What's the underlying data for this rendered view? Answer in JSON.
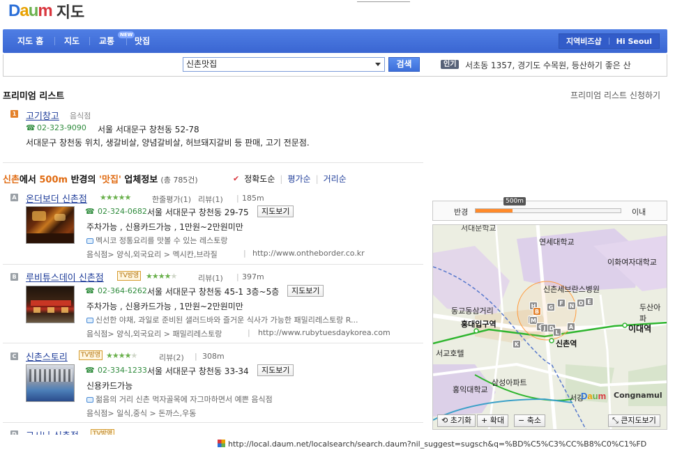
{
  "header": {
    "logo_text": "Daum",
    "title": "지도"
  },
  "nav": {
    "items": [
      "지도 홈",
      "지도",
      "교통",
      "맛집"
    ],
    "new_badge": "NEW",
    "right": [
      "지역비즈샵",
      "Hi Seoul"
    ]
  },
  "search": {
    "query": "신촌맛집",
    "button": "검색",
    "popular_badge": "인기",
    "popular_text": "서초동 1357, 경기도 수목원, 등산하기 좋은 산"
  },
  "premium": {
    "title": "프리미엄 리스트",
    "apply_link": "프리미엄 리스트 신청하기",
    "item": {
      "num": "1",
      "name": "고기창고",
      "category": "음식점",
      "phone": "02-323-9090",
      "address": "서울 서대문구 창천동 52-78",
      "desc": "서대문구 창천동 위치, 생갈비살, 양념갈비살, 허브돼지갈비 등 판매, 고기 전문점."
    }
  },
  "section": {
    "place": "신촌",
    "mid1": "에서 ",
    "radius": "500m",
    "mid2": " 반경의 ",
    "keyword": "'맛집'",
    "tail": " 업체정보",
    "count": "(총 785건)",
    "sorts": [
      "정확도순",
      "평가순",
      "거리순"
    ]
  },
  "results": [
    {
      "num": "A",
      "name": "온더보더 신촌점",
      "rating": 5,
      "rating_label": "한줄평가(1)",
      "review": "리뷰(1)",
      "distance": "185m",
      "phone": "02-324-0682",
      "address": "서울 서대문구 창천동 29-75",
      "map_button": "지도보기",
      "info": "주차가능 , 신용카드가능 , 1만원~2만원미만",
      "desc": "멕시코 정통요리를 맛볼 수 있는 레스토랑",
      "category": "음식점> 양식,외국요리 > 멕시칸,브라질",
      "url": "http://www.ontheborder.co.kr"
    },
    {
      "num": "B",
      "name": "루비튜스데이 신촌점",
      "tv": "TV방영",
      "rating": 4,
      "review": "리뷰(1)",
      "distance": "397m",
      "phone": "02-364-6262",
      "address": "서울 서대문구 창천동 45-1 3층~5층",
      "map_button": "지도보기",
      "info": "주차가능 , 신용카드가능 , 1만원~2만원미만",
      "desc": "신선한 야채, 과일로 준비된 샐러드바와 즐거운 식사가 가능한 패밀리레스토랑 R...",
      "category": "음식점> 양식,외국요리 > 패밀리레스토랑",
      "url": "http://www.rubytuesdaykorea.com"
    },
    {
      "num": "C",
      "name": "신촌스토리",
      "tv": "TV방영",
      "rating": 4,
      "review": "리뷰(2)",
      "distance": "308m",
      "phone": "02-334-1233",
      "address": "서울 서대문구 창천동 33-34",
      "map_button": "지도보기",
      "info": "신용카드가능",
      "desc": "젊음의 거리 신촌 먹자골목에 자그마하면서 예쁜 음식점",
      "category": "음식점> 일식,중식 > 돈까스,우동"
    },
    {
      "num": "D",
      "name": "고시나 신촌점",
      "tv": "TV방영"
    }
  ],
  "map": {
    "radius_label": "반경",
    "radius_value": "500m",
    "radius_level": 0.25,
    "radius_suffix": "이내",
    "labels": {
      "yonsei": "연세대학교",
      "severance": "신촌세브란스병원",
      "ewha": "이화여자대학교",
      "ewha_station": "이대역",
      "dongkyo": "동교동삼거리",
      "hongik_station": "홍대입구역",
      "sinchon_station": "신촌역",
      "seogyo_hotel": "서교호텔",
      "hongik_univ": "홍익대학교",
      "samsung_apt": "삼성아파트",
      "sogang": "서강",
      "dusan": "두산아파",
      "top_partial": "서대문학교"
    },
    "markers": [
      "H",
      "G",
      "F",
      "N",
      "O",
      "E",
      "I",
      "M",
      "C",
      "J",
      "D",
      "L",
      "A",
      "K",
      "B"
    ],
    "brand_left": "Daum",
    "brand_right": "Congnamul",
    "buttons": [
      "초기화",
      "확대",
      "축소",
      "큰지도보기"
    ]
  },
  "status": {
    "url": "http://local.daum.net/localsearch/search.daum?nil_suggest=sugsch&q=%BD%C5%C3%CC%B8%C0%C1%FD"
  }
}
